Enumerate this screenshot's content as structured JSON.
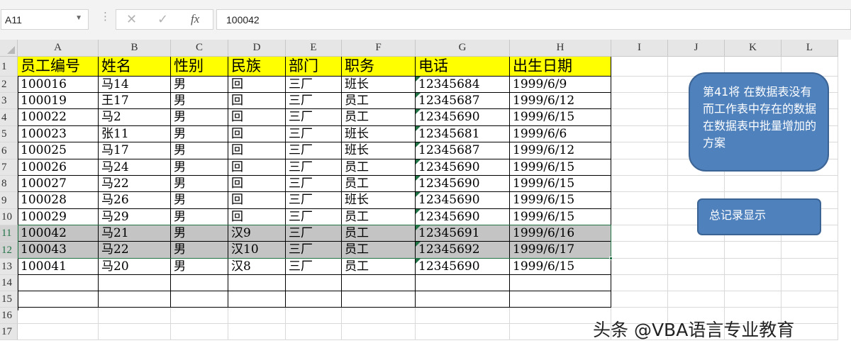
{
  "formula_bar": {
    "name_box": "A11",
    "cancel_icon": "✕",
    "enter_icon": "✓",
    "function_icon": "fx",
    "formula_value": "100042"
  },
  "columns": [
    "A",
    "B",
    "C",
    "D",
    "E",
    "F",
    "G",
    "H",
    "I",
    "J",
    "K",
    "L"
  ],
  "rows": [
    "1",
    "2",
    "3",
    "4",
    "5",
    "6",
    "7",
    "8",
    "9",
    "10",
    "11",
    "12",
    "13",
    "14",
    "15",
    "16",
    "17"
  ],
  "table": {
    "headers": [
      "员工编号",
      "姓名",
      "性别",
      "民族",
      "部门",
      "职务",
      "电话",
      "出生日期"
    ],
    "data": [
      [
        "100016",
        "马14",
        "男",
        "回",
        "三厂",
        "班长",
        "12345684",
        "1999/6/9"
      ],
      [
        "100019",
        "王17",
        "男",
        "回",
        "三厂",
        "员工",
        "12345687",
        "1999/6/12"
      ],
      [
        "100022",
        "马2",
        "男",
        "回",
        "三厂",
        "员工",
        "12345690",
        "1999/6/15"
      ],
      [
        "100023",
        "张11",
        "男",
        "回",
        "三厂",
        "班长",
        "12345681",
        "1999/6/6"
      ],
      [
        "100025",
        "马17",
        "男",
        "回",
        "三厂",
        "班长",
        "12345687",
        "1999/6/12"
      ],
      [
        "100026",
        "马24",
        "男",
        "回",
        "三厂",
        "员工",
        "12345690",
        "1999/6/15"
      ],
      [
        "100027",
        "马22",
        "男",
        "回",
        "三厂",
        "员工",
        "12345690",
        "1999/6/15"
      ],
      [
        "100028",
        "马26",
        "男",
        "回",
        "三厂",
        "班长",
        "12345690",
        "1999/6/15"
      ],
      [
        "100029",
        "马29",
        "男",
        "回",
        "三厂",
        "员工",
        "12345690",
        "1999/6/15"
      ],
      [
        "100042",
        "马21",
        "男",
        "汉9",
        "三厂",
        "员工",
        "12345691",
        "1999/6/16"
      ],
      [
        "100043",
        "马22",
        "男",
        "汉10",
        "三厂",
        "员工",
        "12345692",
        "1999/6/17"
      ],
      [
        "100041",
        "马20",
        "男",
        "汉8",
        "三厂",
        "员工",
        "12345690",
        "1999/6/15"
      ]
    ],
    "selected_rows": [
      "11",
      "12"
    ]
  },
  "shapes": {
    "note": "第41将 在数据表没有而工作表中存在的数据在数据表中批量增加的方案",
    "record_button": "总记录显示"
  },
  "watermark": "头条 @VBA语言专业教育",
  "colors": {
    "header_fill": "#ffff00",
    "selection_fill": "#c4c4c4",
    "selection_border": "#217346",
    "shape_fill": "#4f81bd"
  }
}
